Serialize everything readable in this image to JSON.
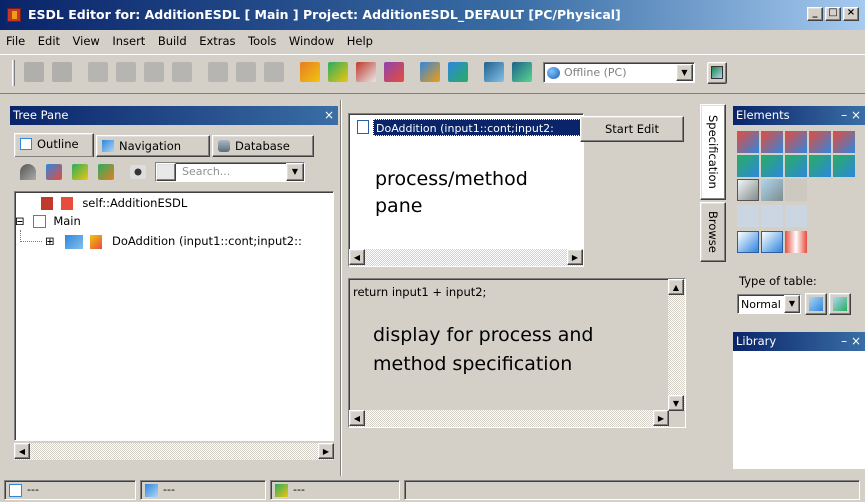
{
  "window": {
    "title": "ESDL Editor for: AdditionESDL [ Main ] Project: AdditionESDL_DEFAULT [PC/Physical]",
    "controls": {
      "minimize": "_",
      "maximize": "□",
      "close": "×"
    }
  },
  "menu": [
    "File",
    "Edit",
    "View",
    "Insert",
    "Build",
    "Extras",
    "Tools",
    "Window",
    "Help"
  ],
  "toolbar": {
    "target_combo": {
      "value": "Offline (PC)",
      "icon": "globe-icon"
    }
  },
  "tree_pane": {
    "title": "Tree Pane",
    "close": "×",
    "tabs": [
      {
        "label": "Outline",
        "icon": "outline-icon",
        "active": true
      },
      {
        "label": "Navigation",
        "icon": "navigation-icon",
        "active": false
      },
      {
        "label": "Database",
        "icon": "database-icon",
        "active": false
      }
    ],
    "search_placeholder": "Search...",
    "items": [
      {
        "label": "self::AdditionESDL",
        "icon": "class-icon"
      },
      {
        "label": "Main",
        "icon": "module-icon",
        "expander": "⊟"
      },
      {
        "label": "DoAddition (input1::cont;input2::",
        "icon": "process-icon",
        "expander": "⊞"
      }
    ]
  },
  "process_pane": {
    "selected_item": "DoAddition (input1::cont;input2:",
    "start_edit": "Start Edit",
    "annotation": "process/method\npane"
  },
  "spec_pane": {
    "code": "return input1 + input2;",
    "annotation": "display for process and\nmethod specification"
  },
  "side_tabs": {
    "specification": "Specification",
    "browse": "Browse"
  },
  "elements_pane": {
    "title": "Elements",
    "close": "– ×",
    "type_of_table_label": "Type of table:",
    "type_of_table_value": "Normal"
  },
  "library_pane": {
    "title": "Library",
    "close": "– ×"
  },
  "status": [
    "---",
    "---",
    "---"
  ]
}
